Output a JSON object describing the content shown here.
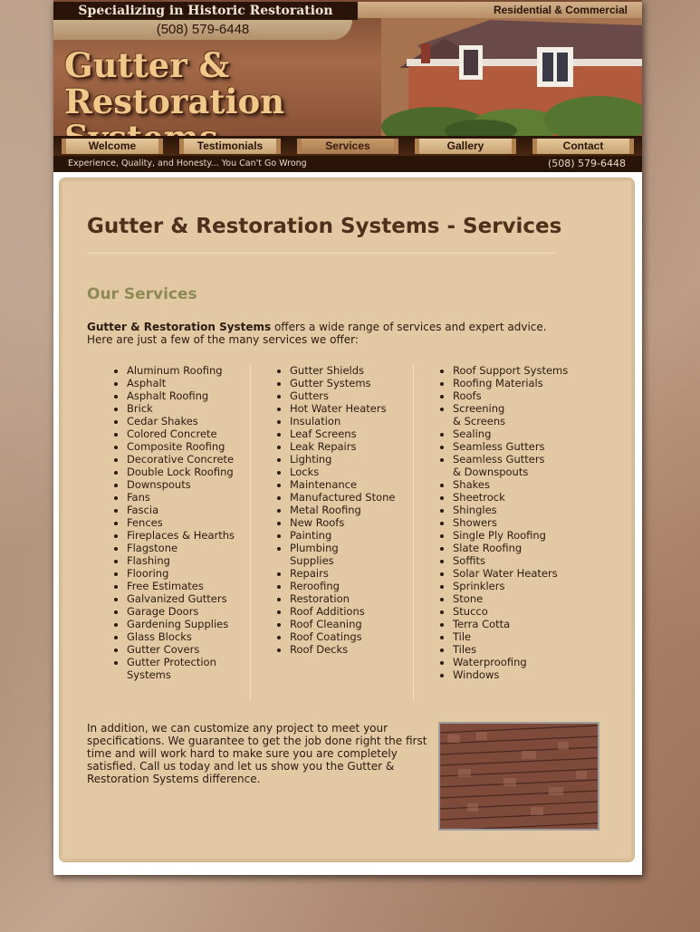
{
  "header": {
    "tagline": "Specializing in Historic Restoration",
    "phone": "(508) 579-6448",
    "market": "Residential & Commercial",
    "logo_line1": "Gutter & Restoration",
    "logo_line2": "Systems"
  },
  "nav": {
    "items": [
      "Welcome",
      "Testimonials",
      "Services",
      "Gallery",
      "Contact"
    ],
    "active": "Services"
  },
  "subbar": {
    "motto": "Experience, Quality, and Honesty... You Can't Go Wrong",
    "phone": "(508) 579-6448"
  },
  "main": {
    "title": "Gutter & Restoration Systems - Services",
    "subtitle": "Our Services",
    "intro_bold": "Gutter & Restoration Systems",
    "intro_rest": " offers a wide range of services and expert advice.",
    "intro_line2": "Here are just a few of the many services we offer:",
    "columns": [
      [
        "Aluminum Roofing",
        "Asphalt",
        "Asphalt Roofing",
        "Brick",
        "Cedar Shakes",
        "Colored Concrete",
        "Composite Roofing",
        "Decorative Concrete",
        "Double Lock Roofing",
        "Downspouts",
        "Fans",
        "Fascia",
        "Fences",
        "Fireplaces & Hearths",
        "Flagstone",
        "Flashing",
        "Flooring",
        "Free Estimates",
        "Galvanized Gutters",
        "Garage Doors",
        "Gardening Supplies",
        "Glass Blocks",
        "Gutter Covers",
        "Gutter Protection\nSystems"
      ],
      [
        "Gutter Shields",
        "Gutter Systems",
        "Gutters",
        "Hot Water Heaters",
        "Insulation",
        "Leaf Screens",
        "Leak Repairs",
        "Lighting",
        "Locks",
        "Maintenance",
        "Manufactured Stone",
        "Metal Roofing",
        "New Roofs",
        "Painting",
        "Plumbing\nSupplies",
        "Repairs",
        "Reroofing",
        "Restoration",
        "Roof Additions",
        "Roof Cleaning",
        "Roof Coatings",
        "Roof Decks"
      ],
      [
        "Roof Support Systems",
        "Roofing Materials",
        "Roofs",
        "Screening\n& Screens",
        "Sealing",
        "Seamless Gutters",
        "Seamless Gutters\n& Downspouts",
        "Shakes",
        "Sheetrock",
        "Shingles",
        "Showers",
        "Single Ply Roofing",
        "Slate Roofing",
        "Soffits",
        "Solar Water Heaters",
        "Sprinklers",
        "Stone",
        "Stucco",
        "Terra Cotta",
        "Tile",
        "Tiles",
        "Waterproofing",
        "Windows"
      ]
    ],
    "outro": "In addition, we can customize any project to meet your specifications. We guarantee to get the job done right the first time and will work hard to make sure you are completely satisfied. Call us today and let us show you the Gutter & Restoration Systems difference."
  },
  "colors": {
    "title": "#4f2f1c",
    "subtitle": "#8d8a55",
    "content_bg": "#e3c9a3",
    "header_dark": "#2a1408"
  }
}
